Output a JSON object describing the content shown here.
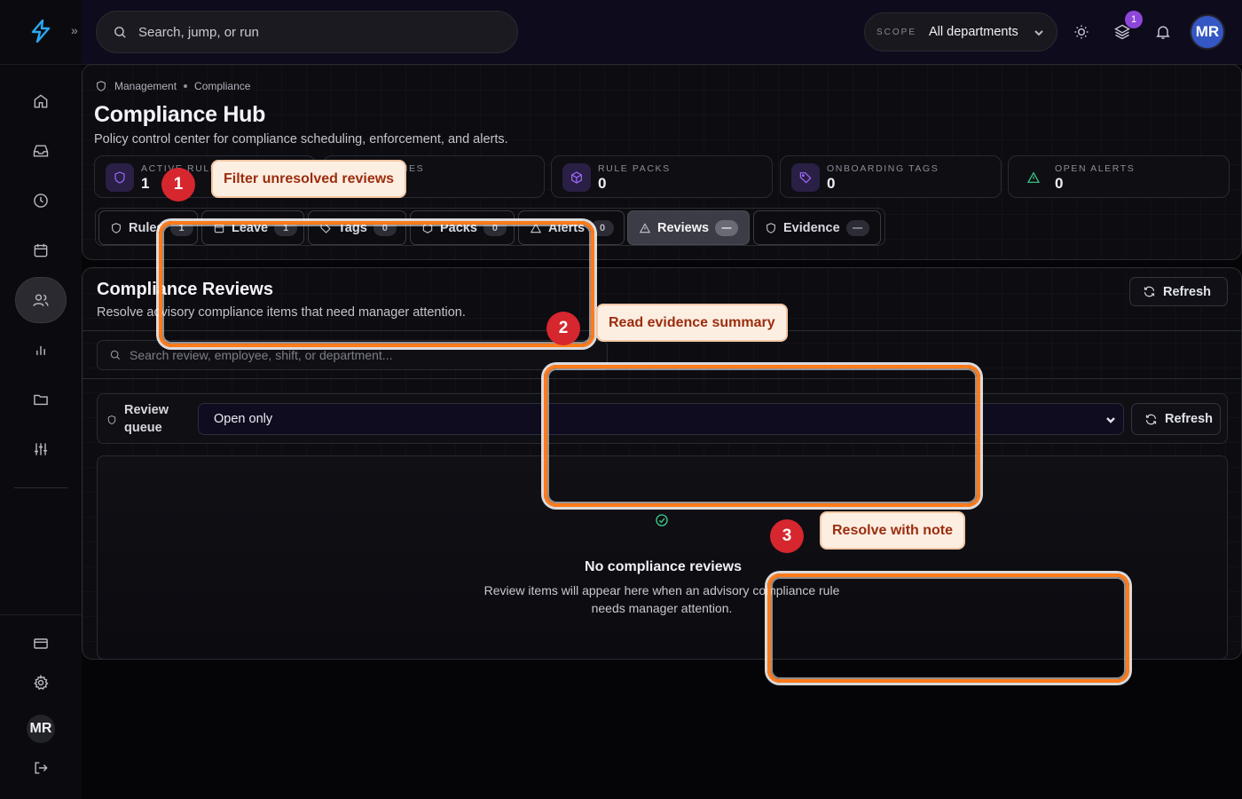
{
  "topbar": {
    "search_placeholder": "Search, jump, or run",
    "scope_label": "SCOPE",
    "scope_value": "All departments",
    "notification_count": "1",
    "avatar_initials": "MR"
  },
  "sidebar": {
    "items": [
      {
        "icon": "home-icon"
      },
      {
        "icon": "inbox-icon"
      },
      {
        "icon": "clock-icon"
      },
      {
        "icon": "calendar-icon"
      },
      {
        "icon": "users-icon",
        "active": true
      },
      {
        "icon": "chart-icon"
      },
      {
        "icon": "folder-icon"
      },
      {
        "icon": "sliders-icon"
      }
    ],
    "bottom": [
      {
        "icon": "card-icon"
      },
      {
        "icon": "gear-icon"
      }
    ],
    "avatar_initials": "MR"
  },
  "hub": {
    "breadcrumb": [
      "Management",
      "Compliance"
    ],
    "title": "Compliance Hub",
    "subtitle": "Policy control center for compliance scheduling, enforcement, and alerts.",
    "stats": [
      {
        "label": "ACTIVE RULES",
        "value": "1",
        "icon": "shield-icon",
        "color": "#9a6bff"
      },
      {
        "label": "POLICIES",
        "value": "",
        "icon": "file-icon",
        "color": "#6f8cff"
      },
      {
        "label": "RULE PACKS",
        "value": "0",
        "icon": "package-icon",
        "color": "#a06bff"
      },
      {
        "label": "ONBOARDING TAGS",
        "value": "0",
        "icon": "tag-icon",
        "color": "#a06bff"
      },
      {
        "label": "OPEN ALERTS",
        "value": "0",
        "icon": "alert-triangle-icon",
        "color": "#3fcf8e"
      }
    ],
    "tabs": [
      {
        "label": "Rules",
        "count": "1"
      },
      {
        "label": "Leave",
        "count": "1"
      },
      {
        "label": "Tags",
        "count": "0"
      },
      {
        "label": "Packs",
        "count": "0"
      },
      {
        "label": "Alerts",
        "count": "0"
      },
      {
        "label": "Reviews",
        "count": "—",
        "active": true
      },
      {
        "label": "Evidence",
        "count": "—"
      }
    ]
  },
  "reviews": {
    "title": "Compliance Reviews",
    "subtitle": "Resolve advisory compliance items that need manager attention.",
    "refresh_label": "Refresh",
    "search_placeholder": "Search review, employee, shift, or department...",
    "queue_label": "Review queue",
    "queue_value": "Open only",
    "queue_refresh_label": "Refresh",
    "empty_title": "No compliance reviews",
    "empty_text": "Review items will appear here when an advisory compliance rule needs manager attention."
  },
  "annotations": [
    {
      "step": "1",
      "text": "Filter unresolved reviews"
    },
    {
      "step": "2",
      "text": "Read evidence summary"
    },
    {
      "step": "3",
      "text": "Resolve with note"
    }
  ],
  "colors": {
    "accent": "#ff7a1a",
    "step_badge": "#d6262e",
    "success": "#3fcf8e",
    "avatar": "#3557c4"
  }
}
